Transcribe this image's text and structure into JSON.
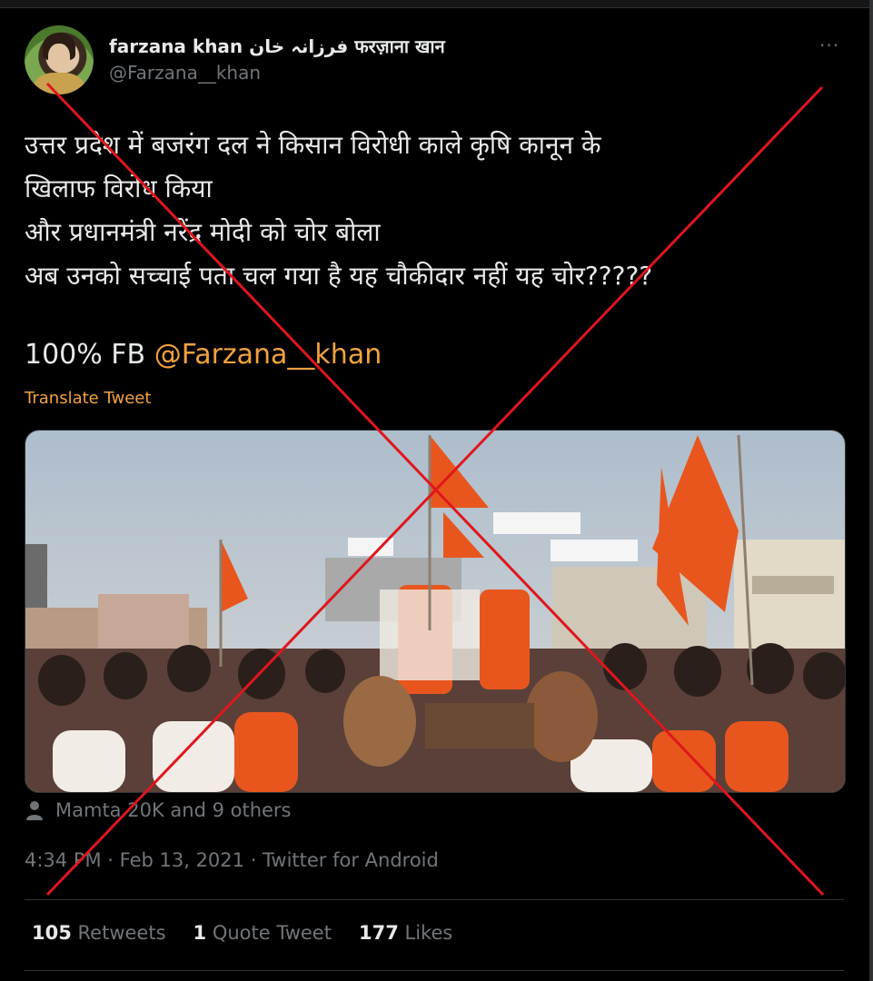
{
  "tweet": {
    "display_name": "farzana khan فرزانہ خان फरज़ाना खान",
    "handle": "@Farzana__khan",
    "more_label": "···",
    "lines": [
      "उत्तर प्रदेश में बजरंग दल ने किसान विरोधी काले कृषि कानून के",
      "खिलाफ विरोध किया",
      "और प्रधानमंत्री नरेंद्र मोदी को चोर बोला",
      "अब उनको सच्चाई पता चल गया है यह चौकीदार नहीं यह चोर?????"
    ],
    "fb_prefix": "100% FB ",
    "fb_mention": "@Farzana__khan",
    "translate_label": "Translate Tweet",
    "tagged": "Mamta 20K and 9 others",
    "meta": "4:34 PM · Feb 13, 2021 · Twitter for Android"
  },
  "stats": {
    "retweets_count": "105",
    "retweets_label": "Retweets",
    "quotes_count": "1",
    "quotes_label": "Quote Tweet",
    "likes_count": "177",
    "likes_label": "Likes"
  },
  "colors": {
    "background": "#000000",
    "text": "#e7e9ea",
    "muted": "#71767b",
    "mention": "#f1a23e",
    "cross": "#e0161d",
    "flag": "#e8561e"
  },
  "icons": [
    "user-icon",
    "more-icon"
  ]
}
